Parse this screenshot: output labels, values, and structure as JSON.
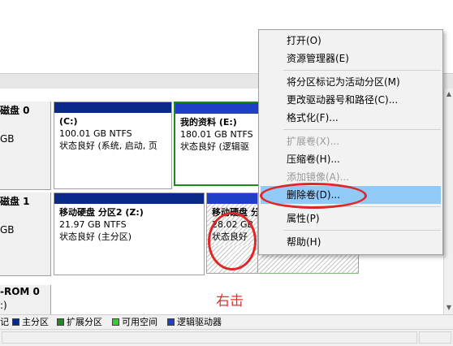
{
  "disks": [
    {
      "name": "磁盘 0",
      "size": "GB",
      "status": "",
      "partitions": [
        {
          "name": "(C:)",
          "detail": "100.01 GB NTFS",
          "status": "状态良好 (系统, 启动, 页"
        },
        {
          "name": "我的资料  (E:)",
          "detail": "180.01 GB NTFS",
          "status": "状态良好 (逻辑驱"
        }
      ]
    },
    {
      "name": "磁盘 1",
      "size": "GB",
      "status": "",
      "partitions": [
        {
          "name": "移动硬盘 分区2  (Z:)",
          "detail": "21.97 GB NTFS",
          "status": "状态良好 (主分区)"
        },
        {
          "name": "移动硬盘 分",
          "detail": "28.02 GB",
          "status": "状态良好"
        }
      ]
    }
  ],
  "cdrom": {
    "name": "-ROM 0",
    "detail": ":)"
  },
  "annotation_label": "右击",
  "legend": {
    "items": [
      {
        "label": "",
        "color": "#000000"
      },
      {
        "label": "主分区",
        "color": "#0a2a8a"
      },
      {
        "label": "扩展分区",
        "color": "#1f8a1f"
      },
      {
        "label": "可用空间",
        "color": "#33cc33"
      },
      {
        "label": "逻辑驱动器",
        "color": "#1f3fc7"
      }
    ]
  },
  "legend_first_partial": "记",
  "context_menu": {
    "items": [
      {
        "label": "打开(O)",
        "enabled": true
      },
      {
        "label": "资源管理器(E)",
        "enabled": true
      },
      {
        "separator": true
      },
      {
        "label": "将分区标记为活动分区(M)",
        "enabled": true
      },
      {
        "label": "更改驱动器号和路径(C)...",
        "enabled": true
      },
      {
        "label": "格式化(F)...",
        "enabled": true
      },
      {
        "separator": true
      },
      {
        "label": "扩展卷(X)...",
        "enabled": false
      },
      {
        "label": "压缩卷(H)...",
        "enabled": true
      },
      {
        "label": "添加镜像(A)...",
        "enabled": false
      },
      {
        "label": "删除卷(D)...",
        "enabled": true,
        "highlighted": true
      },
      {
        "separator": true
      },
      {
        "label": "属性(P)",
        "enabled": true
      },
      {
        "separator": true
      },
      {
        "label": "帮助(H)",
        "enabled": true
      }
    ]
  },
  "colors": {
    "primary_partition": "#0a2a8a",
    "logical_drive": "#1f3fc7",
    "selection": "#1a8a1a",
    "annotation": "#e02626",
    "menu_highlight": "#91c9f7"
  }
}
